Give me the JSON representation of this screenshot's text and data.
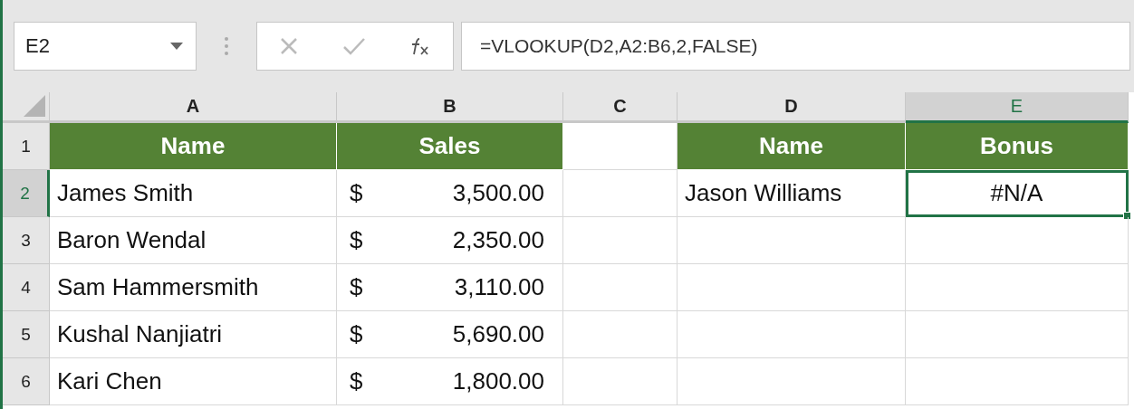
{
  "name_box": {
    "value": "E2"
  },
  "formula_bar": {
    "value": "=VLOOKUP(D2,A2:B6,2,FALSE)"
  },
  "columns": [
    {
      "label": "A",
      "selected": false
    },
    {
      "label": "B",
      "selected": false
    },
    {
      "label": "C",
      "selected": false
    },
    {
      "label": "D",
      "selected": false
    },
    {
      "label": "E",
      "selected": true
    }
  ],
  "rows": [
    {
      "label": "1",
      "selected": false,
      "cells": [
        {
          "kind": "header",
          "text": "Name"
        },
        {
          "kind": "header",
          "text": "Sales"
        },
        {
          "kind": "empty"
        },
        {
          "kind": "header",
          "text": "Name"
        },
        {
          "kind": "header",
          "text": "Bonus"
        }
      ]
    },
    {
      "label": "2",
      "selected": true,
      "cells": [
        {
          "kind": "text",
          "text": "James Smith"
        },
        {
          "kind": "currency",
          "symbol": "$",
          "value": "3,500.00"
        },
        {
          "kind": "empty"
        },
        {
          "kind": "text",
          "text": "Jason Williams"
        },
        {
          "kind": "center",
          "text": "#N/A"
        }
      ]
    },
    {
      "label": "3",
      "selected": false,
      "cells": [
        {
          "kind": "text",
          "text": "Baron Wendal"
        },
        {
          "kind": "currency",
          "symbol": "$",
          "value": "2,350.00"
        },
        {
          "kind": "empty"
        },
        {
          "kind": "empty"
        },
        {
          "kind": "empty"
        }
      ]
    },
    {
      "label": "4",
      "selected": false,
      "cells": [
        {
          "kind": "text",
          "text": "Sam Hammersmith"
        },
        {
          "kind": "currency",
          "symbol": "$",
          "value": "3,110.00"
        },
        {
          "kind": "empty"
        },
        {
          "kind": "empty"
        },
        {
          "kind": "empty"
        }
      ]
    },
    {
      "label": "5",
      "selected": false,
      "cells": [
        {
          "kind": "text",
          "text": "Kushal Nanjiatri"
        },
        {
          "kind": "currency",
          "symbol": "$",
          "value": "5,690.00"
        },
        {
          "kind": "empty"
        },
        {
          "kind": "empty"
        },
        {
          "kind": "empty"
        }
      ]
    },
    {
      "label": "6",
      "selected": false,
      "cells": [
        {
          "kind": "text",
          "text": "Kari Chen"
        },
        {
          "kind": "currency",
          "symbol": "$",
          "value": "1,800.00"
        },
        {
          "kind": "empty"
        },
        {
          "kind": "empty"
        },
        {
          "kind": "empty"
        }
      ]
    }
  ]
}
